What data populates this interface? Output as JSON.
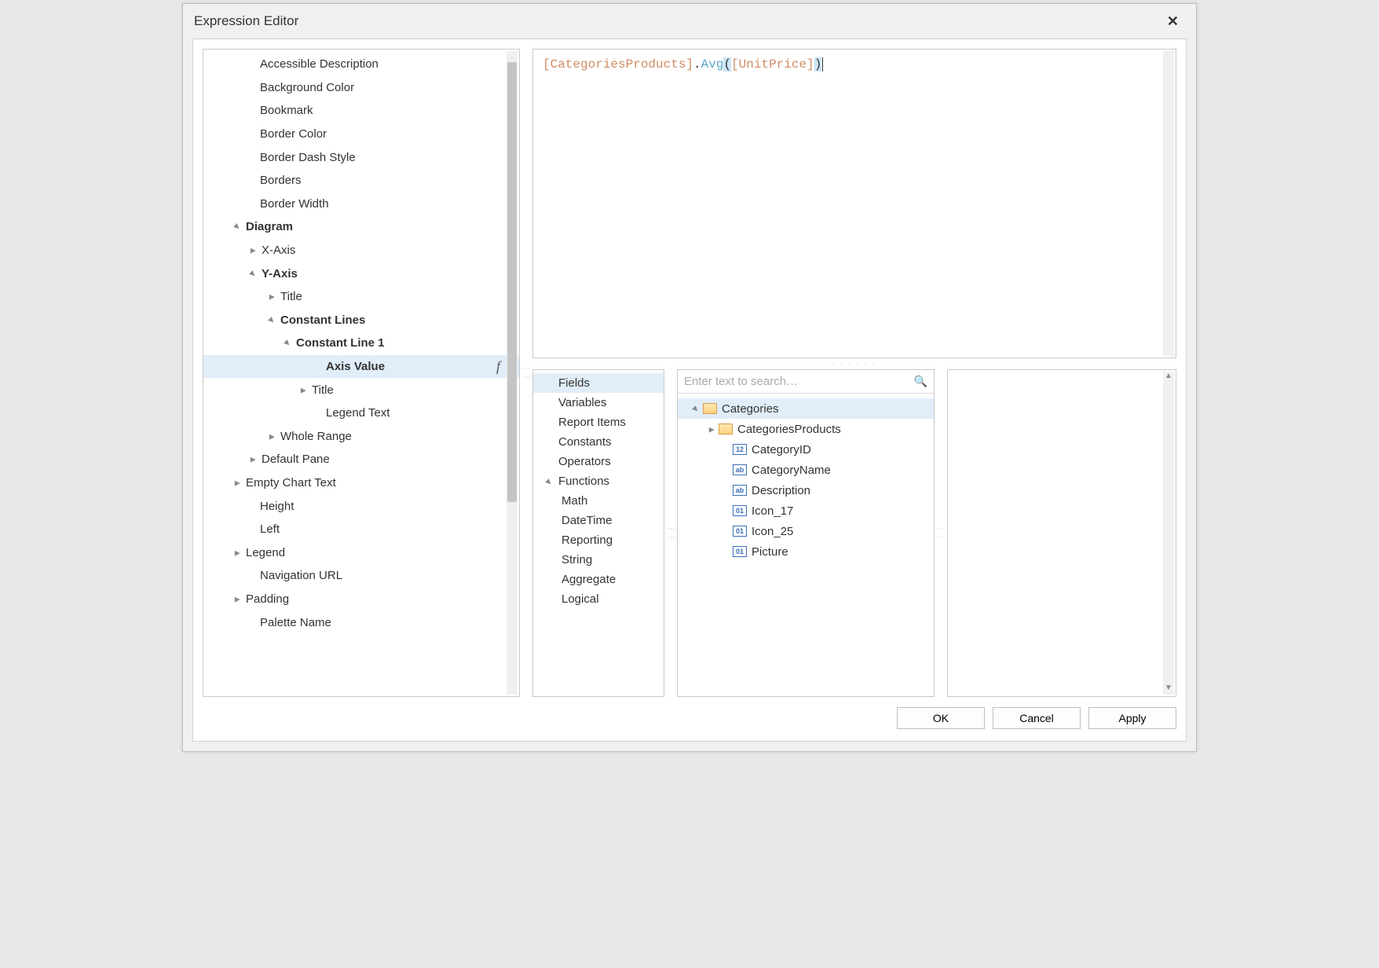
{
  "title": "Expression Editor",
  "expression": {
    "field": "[CategoriesProducts]",
    "dot": ".",
    "func": "Avg",
    "open": "(",
    "arg": "[UnitPrice]",
    "close": ")"
  },
  "left_tree": [
    {
      "label": "Accessible Description",
      "indent": 54,
      "exp": ""
    },
    {
      "label": "Background Color",
      "indent": 54,
      "exp": ""
    },
    {
      "label": "Bookmark",
      "indent": 54,
      "exp": ""
    },
    {
      "label": "Border Color",
      "indent": 54,
      "exp": ""
    },
    {
      "label": "Border Dash Style",
      "indent": 54,
      "exp": ""
    },
    {
      "label": "Borders",
      "indent": 54,
      "exp": ""
    },
    {
      "label": "Border Width",
      "indent": 54,
      "exp": ""
    },
    {
      "label": "Diagram",
      "indent": 36,
      "exp": "open",
      "bold": true
    },
    {
      "label": "X-Axis",
      "indent": 56,
      "exp": "closed"
    },
    {
      "label": "Y-Axis",
      "indent": 56,
      "exp": "open",
      "bold": true
    },
    {
      "label": "Title",
      "indent": 80,
      "exp": "closed"
    },
    {
      "label": "Constant Lines",
      "indent": 80,
      "exp": "open",
      "bold": true
    },
    {
      "label": "Constant Line 1",
      "indent": 100,
      "exp": "open",
      "bold": true
    },
    {
      "label": "Axis Value",
      "indent": 138,
      "exp": "",
      "bold": true,
      "sel": true,
      "fx": true
    },
    {
      "label": "Title",
      "indent": 120,
      "exp": "closed"
    },
    {
      "label": "Legend Text",
      "indent": 138,
      "exp": ""
    },
    {
      "label": "Whole Range",
      "indent": 80,
      "exp": "closed"
    },
    {
      "label": "Default Pane",
      "indent": 56,
      "exp": "closed"
    },
    {
      "label": "Empty Chart Text",
      "indent": 36,
      "exp": "closed"
    },
    {
      "label": "Height",
      "indent": 54,
      "exp": ""
    },
    {
      "label": "Left",
      "indent": 54,
      "exp": ""
    },
    {
      "label": "Legend",
      "indent": 36,
      "exp": "closed"
    },
    {
      "label": "Navigation URL",
      "indent": 54,
      "exp": ""
    },
    {
      "label": "Padding",
      "indent": 36,
      "exp": "closed"
    },
    {
      "label": "Palette Name",
      "indent": 54,
      "exp": ""
    }
  ],
  "categories": [
    {
      "label": "Fields",
      "sel": true
    },
    {
      "label": "Variables"
    },
    {
      "label": "Report Items"
    },
    {
      "label": "Constants"
    },
    {
      "label": "Operators"
    },
    {
      "label": "Functions",
      "exp": "open"
    },
    {
      "label": "Math",
      "sub": true
    },
    {
      "label": "DateTime",
      "sub": true
    },
    {
      "label": "Reporting",
      "sub": true
    },
    {
      "label": "String",
      "sub": true
    },
    {
      "label": "Aggregate",
      "sub": true
    },
    {
      "label": "Logical",
      "sub": true
    }
  ],
  "search_placeholder": "Enter text to search…",
  "fields": [
    {
      "label": "Categories",
      "indent": 8,
      "exp": "open",
      "icon": "tbl",
      "sel": true
    },
    {
      "label": "CategoriesProducts",
      "indent": 28,
      "exp": "closed",
      "icon": "tbl"
    },
    {
      "label": "CategoryID",
      "indent": 46,
      "icon": "num",
      "glyph": "12"
    },
    {
      "label": "CategoryName",
      "indent": 46,
      "icon": "txt",
      "glyph": "ab"
    },
    {
      "label": "Description",
      "indent": 46,
      "icon": "txt",
      "glyph": "ab"
    },
    {
      "label": "Icon_17",
      "indent": 46,
      "icon": "bin",
      "glyph": "01"
    },
    {
      "label": "Icon_25",
      "indent": 46,
      "icon": "bin",
      "glyph": "01"
    },
    {
      "label": "Picture",
      "indent": 46,
      "icon": "bin",
      "glyph": "01"
    }
  ],
  "buttons": {
    "ok": "OK",
    "cancel": "Cancel",
    "apply": "Apply"
  }
}
